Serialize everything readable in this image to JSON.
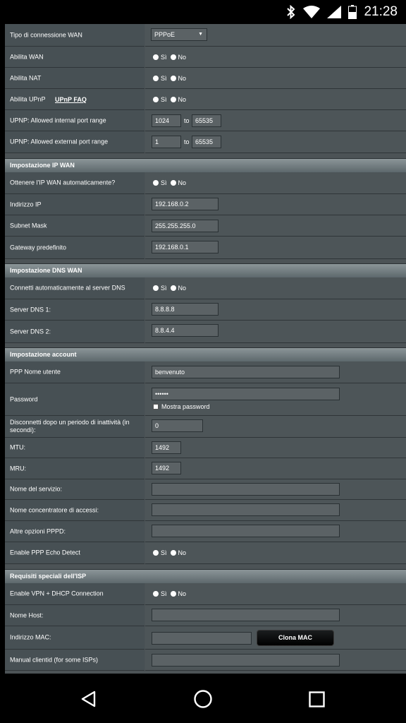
{
  "status_bar": {
    "time": "21:28",
    "icons": [
      "bluetooth-icon",
      "wifi-icon",
      "signal-icon",
      "battery-icon"
    ]
  },
  "wan": {
    "connection_type_label": "Tipo di connessione WAN",
    "connection_type_value": "PPPoE",
    "enable_wan_label": "Abilita WAN",
    "enable_nat_label": "Abilita NAT",
    "enable_upnp_label": "Abilita UPnP",
    "upnp_faq_link": "UPnP FAQ",
    "upnp_internal_label": "UPNP: Allowed internal port range",
    "upnp_internal_from": "1024",
    "upnp_internal_to": "65535",
    "upnp_external_label": "UPNP: Allowed external port range",
    "upnp_external_from": "1",
    "upnp_external_to": "65535",
    "to_label": "to"
  },
  "radio": {
    "yes": "Sì",
    "no": "No"
  },
  "ip_section": {
    "title": "Impostazione IP WAN",
    "auto_ip_label": "Ottenere l'IP WAN automaticamente?",
    "ip_label": "Indirizzo IP",
    "ip_value": "192.168.0.2",
    "mask_label": "Subnet Mask",
    "mask_value": "255.255.255.0",
    "gateway_label": "Gateway predefinito",
    "gateway_value": "192.168.0.1"
  },
  "dns_section": {
    "title": "Impostazione DNS WAN",
    "auto_dns_label": "Connetti automaticamente al server DNS",
    "dns1_label": "Server DNS 1:",
    "dns1_value": "8.8.8.8",
    "dns2_label": "Server DNS 2:",
    "dns2_value": "8.8.4.4"
  },
  "account_section": {
    "title": "Impostazione account",
    "username_label": "PPP Nome utente",
    "username_value": "benvenuto",
    "password_label": "Password",
    "password_value": "••••••",
    "show_password_label": "Mostra password",
    "idle_label": "Disconnetti dopo un periodo di inattività (in secondi):",
    "idle_value": "0",
    "mtu_label": "MTU:",
    "mtu_value": "1492",
    "mru_label": "MRU:",
    "mru_value": "1492",
    "service_label": "Nome del servizio:",
    "concentrator_label": "Nome concentratore di accessi:",
    "pppd_label": "Altre opzioni PPPD:",
    "echo_label": "Enable PPP Echo Detect"
  },
  "isp_section": {
    "title": "Requisiti speciali dell'ISP",
    "vpn_label": "Enable VPN + DHCP Connection",
    "host_label": "Nome Host:",
    "mac_label": "Indirizzo MAC:",
    "clone_mac_button": "Clona MAC",
    "clientid_label": "Manual clientid (for some ISPs)"
  },
  "nav": {
    "icons": [
      "back-icon",
      "home-icon",
      "recents-icon"
    ]
  }
}
